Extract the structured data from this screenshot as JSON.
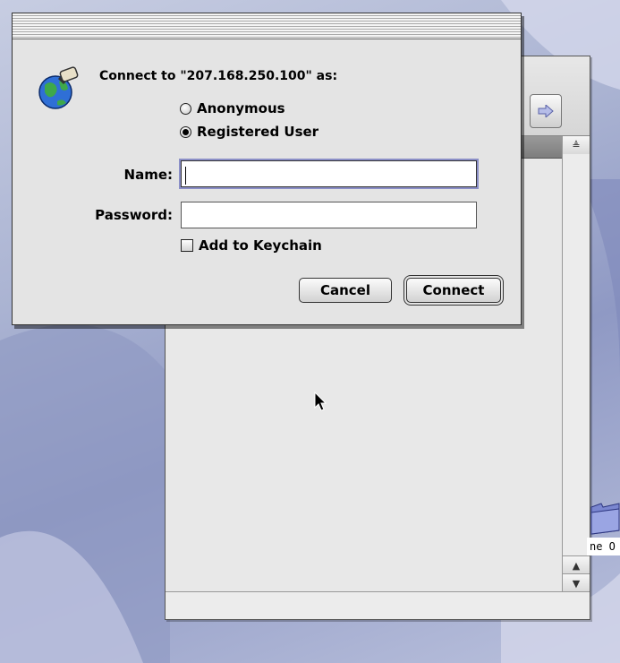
{
  "dialog": {
    "prompt": "Connect to \"207.168.250.100\" as:",
    "options": [
      {
        "label": "Anonymous",
        "selected": false
      },
      {
        "label": "Registered User",
        "selected": true
      }
    ],
    "name_label": "Name:",
    "name_value": "",
    "password_label": "Password:",
    "password_value": "",
    "keychain_label": "Add to Keychain",
    "keychain_checked": false,
    "cancel_label": "Cancel",
    "connect_label": "Connect",
    "icon": "network-globe-icon"
  },
  "desktop": {
    "folder_label": "ne O",
    "folder_icon": "folder-icon"
  },
  "background_window": {
    "forward_icon": "forward-arrow-icon",
    "scroll_up_icon": "scroll-up-icon",
    "scroll_down_icon": "scroll-down-icon",
    "sort_icon": "sort-indicator-icon"
  },
  "colors": {
    "focus_ring": "#8b8fc7",
    "desktop": "#aab3d2",
    "dialog_bg": "#e4e4e4"
  }
}
